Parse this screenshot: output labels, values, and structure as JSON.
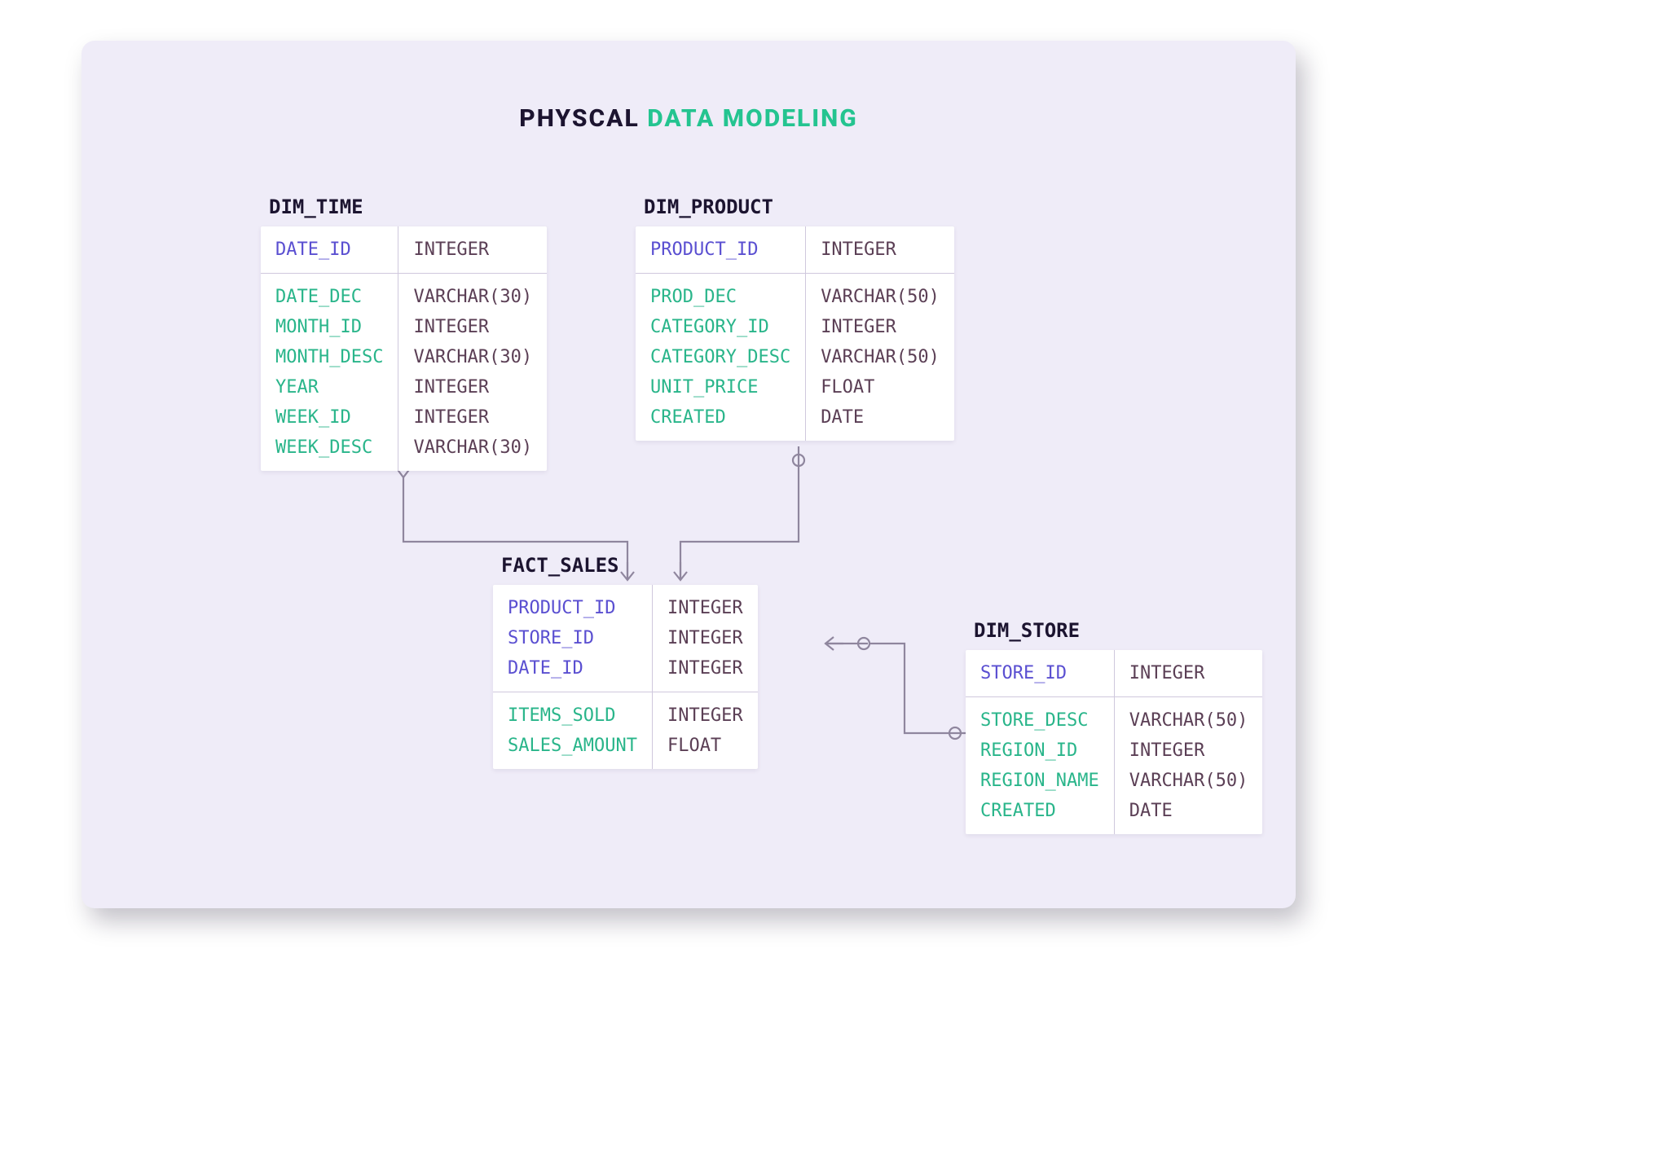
{
  "title": {
    "part1": "PHYSCAL",
    "part2": "DATA MODELING"
  },
  "colors": {
    "canvas_bg": "#efecf8",
    "pk": "#5a4fd1",
    "attr": "#29b58a",
    "type": "#5b3f55",
    "title_accent": "#24c490",
    "title_main": "#1c1430",
    "connector": "#8f869e"
  },
  "entities": {
    "dim_time": {
      "name": "DIM_TIME",
      "pk": [
        {
          "name": "DATE_ID",
          "type": "INTEGER"
        }
      ],
      "attrs": [
        {
          "name": "DATE_DEC",
          "type": "VARCHAR(30)"
        },
        {
          "name": "MONTH_ID",
          "type": "INTEGER"
        },
        {
          "name": "MONTH_DESC",
          "type": "VARCHAR(30)"
        },
        {
          "name": "YEAR",
          "type": "INTEGER"
        },
        {
          "name": "WEEK_ID",
          "type": "INTEGER"
        },
        {
          "name": "WEEK_DESC",
          "type": "VARCHAR(30)"
        }
      ]
    },
    "dim_product": {
      "name": "DIM_PRODUCT",
      "pk": [
        {
          "name": "PRODUCT_ID",
          "type": "INTEGER"
        }
      ],
      "attrs": [
        {
          "name": "PROD_DEC",
          "type": "VARCHAR(50)"
        },
        {
          "name": "CATEGORY_ID",
          "type": "INTEGER"
        },
        {
          "name": "CATEGORY_DESC",
          "type": "VARCHAR(50)"
        },
        {
          "name": "UNIT_PRICE",
          "type": "FLOAT"
        },
        {
          "name": "CREATED",
          "type": "DATE"
        }
      ]
    },
    "fact_sales": {
      "name": "FACT_SALES",
      "pk": [
        {
          "name": "PRODUCT_ID",
          "type": "INTEGER"
        },
        {
          "name": "STORE_ID",
          "type": "INTEGER"
        },
        {
          "name": "DATE_ID",
          "type": "INTEGER"
        }
      ],
      "attrs": [
        {
          "name": "ITEMS_SOLD",
          "type": "INTEGER"
        },
        {
          "name": "SALES_AMOUNT",
          "type": "FLOAT"
        }
      ]
    },
    "dim_store": {
      "name": "DIM_STORE",
      "pk": [
        {
          "name": "STORE_ID",
          "type": "INTEGER"
        }
      ],
      "attrs": [
        {
          "name": "STORE_DESC",
          "type": "VARCHAR(50)"
        },
        {
          "name": "REGION_ID",
          "type": "INTEGER"
        },
        {
          "name": "REGION_NAME",
          "type": "VARCHAR(50)"
        },
        {
          "name": "CREATED",
          "type": "DATE"
        }
      ]
    }
  },
  "relationships": [
    {
      "from": "dim_time",
      "to": "fact_sales",
      "via": "DATE_ID"
    },
    {
      "from": "dim_product",
      "to": "fact_sales",
      "via": "PRODUCT_ID"
    },
    {
      "from": "dim_store",
      "to": "fact_sales",
      "via": "STORE_ID"
    }
  ]
}
